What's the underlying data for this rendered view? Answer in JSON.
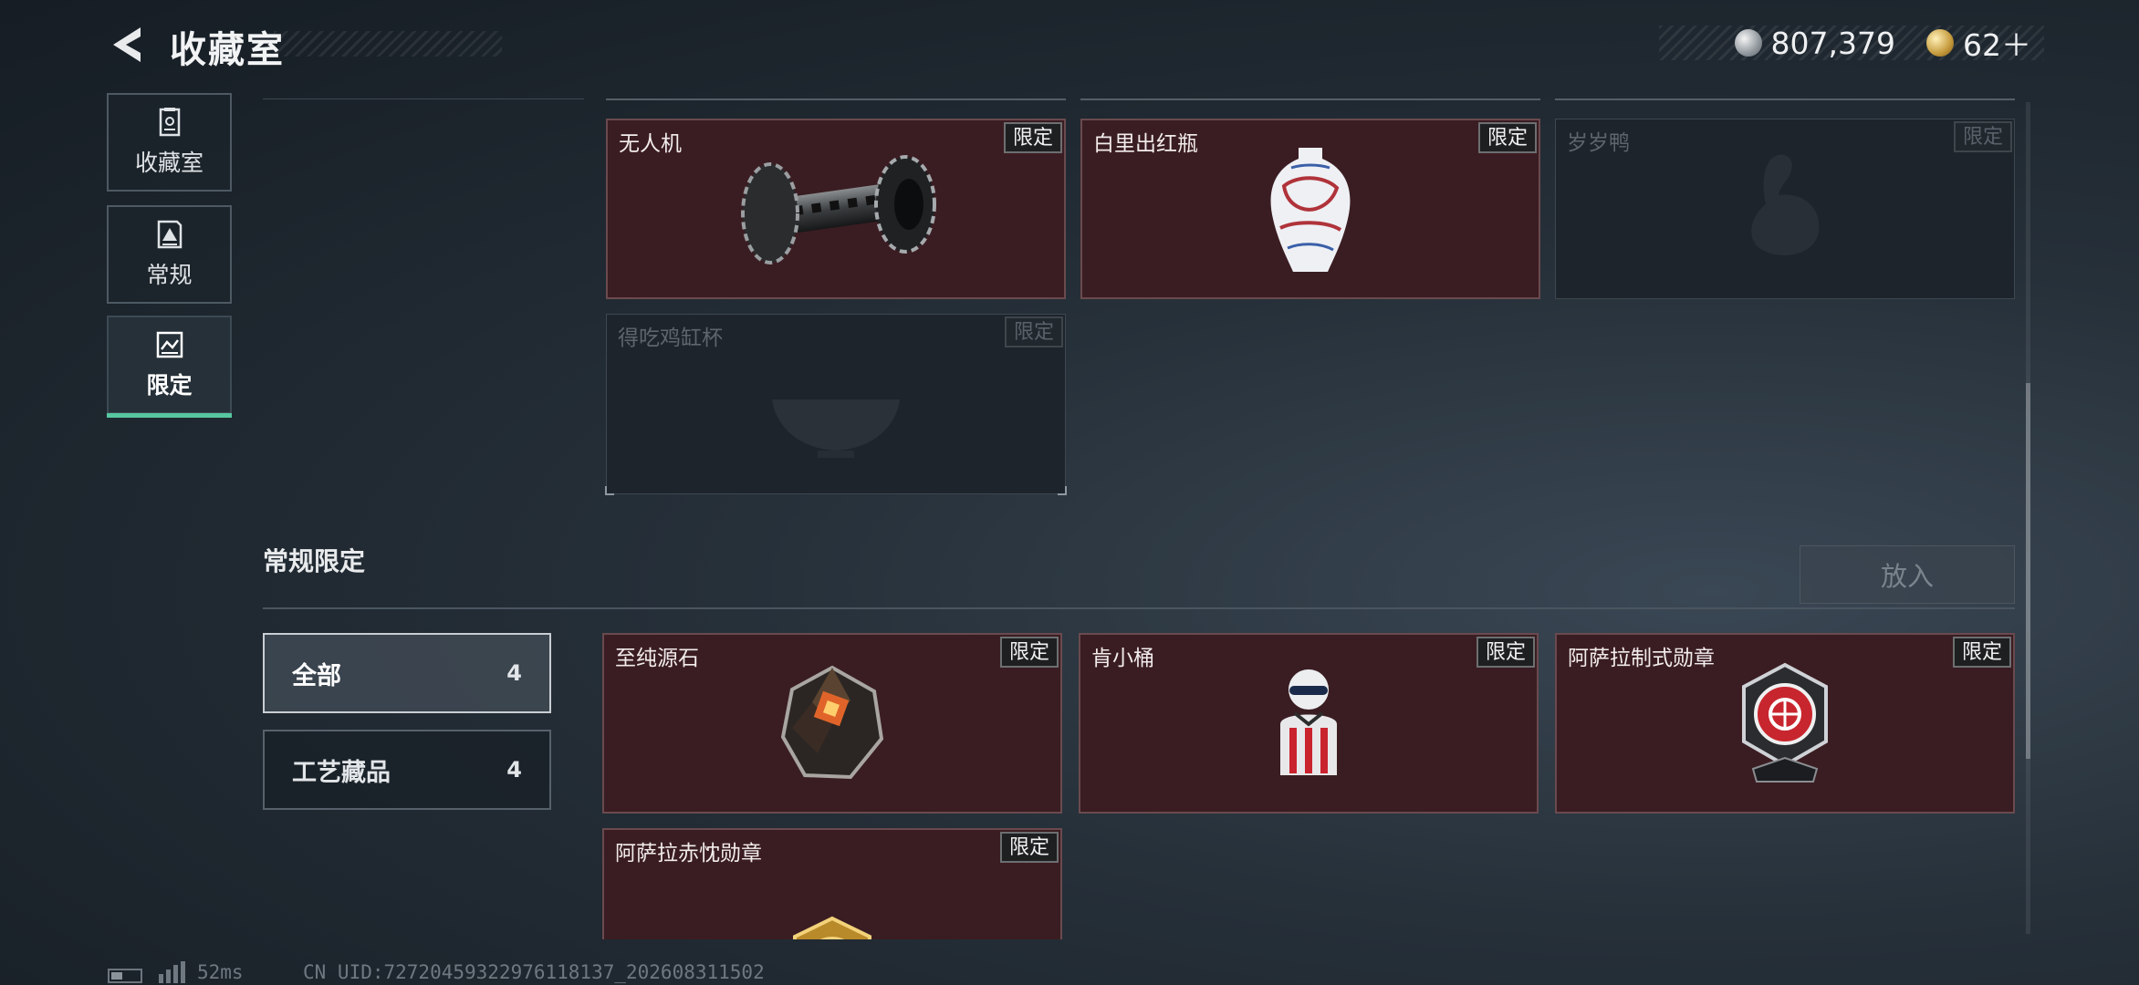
{
  "header": {
    "title": "收藏室",
    "currency": [
      {
        "icon": "silver-coin-icon",
        "value": "807,379"
      },
      {
        "icon": "gold-coin-icon",
        "value": "62＋"
      }
    ]
  },
  "sidebar": {
    "items": [
      {
        "label": "收藏室",
        "icon": "collection-icon",
        "active": false
      },
      {
        "label": "常规",
        "icon": "regular-icon",
        "active": false
      },
      {
        "label": "限定",
        "icon": "limited-icon",
        "active": true
      }
    ]
  },
  "upper_grid": {
    "cards": [
      {
        "name": "无人机",
        "badge": "限定",
        "collected": true,
        "icon": "drone-icon"
      },
      {
        "name": "白里出红瓶",
        "badge": "限定",
        "collected": true,
        "icon": "vase-icon"
      },
      {
        "name": "岁岁鸭",
        "badge": "限定",
        "collected": false,
        "icon": "duck-icon"
      },
      {
        "name": "得吃鸡缸杯",
        "badge": "限定",
        "collected": false,
        "icon": "cup-icon"
      }
    ]
  },
  "section": {
    "title": "常规限定",
    "put_in_label": "放入",
    "filters": [
      {
        "label": "全部",
        "count": "4",
        "active": true
      },
      {
        "label": "工艺藏品",
        "count": "4",
        "active": false
      }
    ],
    "cards": [
      {
        "name": "至纯源石",
        "badge": "限定",
        "collected": true,
        "icon": "gem-icon"
      },
      {
        "name": "肯小桶",
        "badge": "限定",
        "collected": true,
        "icon": "figure-icon"
      },
      {
        "name": "阿萨拉制式勋章",
        "badge": "限定",
        "collected": true,
        "icon": "medal-icon"
      },
      {
        "name": "阿萨拉赤忱勋章",
        "badge": "限定",
        "collected": true,
        "icon": "gold-medal-icon"
      }
    ]
  },
  "footer": {
    "ping": "52ms",
    "uid": "CN UID:72720459322976118137_202608311502"
  },
  "colors": {
    "card_bg": "#3a1d22",
    "accent": "#57c7a1"
  }
}
